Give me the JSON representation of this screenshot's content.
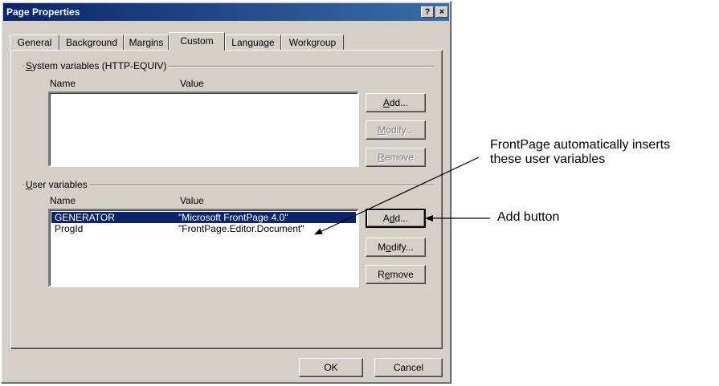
{
  "dialog": {
    "title": "Page Properties",
    "help_label": "?",
    "close_label": "×"
  },
  "tabs": [
    {
      "label": "General"
    },
    {
      "label": "Background"
    },
    {
      "label": "Margins"
    },
    {
      "label": "Custom"
    },
    {
      "label": "Language"
    },
    {
      "label": "Workgroup"
    }
  ],
  "active_tab": "Custom",
  "system_vars": {
    "title_first": "S",
    "title_rest": "ystem variables (HTTP-EQUIV)",
    "col_name": "Name",
    "col_value": "Value",
    "rows": [],
    "buttons": [
      {
        "pre": "",
        "u": "A",
        "post": "dd...",
        "enabled": true
      },
      {
        "pre": "",
        "u": "M",
        "post": "odify...",
        "enabled": false
      },
      {
        "pre": "",
        "u": "R",
        "post": "emove",
        "enabled": false
      }
    ]
  },
  "user_vars": {
    "title_first": "U",
    "title_rest": "ser variables",
    "col_name": "Name",
    "col_value": "Value",
    "rows": [
      {
        "name": "GENERATOR",
        "value": "\"Microsoft FrontPage 4.0\"",
        "selected": true
      },
      {
        "name": "ProgId",
        "value": "\"FrontPage.Editor.Document\"",
        "selected": false
      }
    ],
    "buttons": [
      {
        "pre": "A",
        "u": "d",
        "post": "d...",
        "enabled": true
      },
      {
        "pre": "M",
        "u": "o",
        "post": "dify...",
        "enabled": true
      },
      {
        "pre": "R",
        "u": "e",
        "post": "move",
        "enabled": true
      }
    ]
  },
  "footer": {
    "ok_label": "OK",
    "cancel_label": "Cancel"
  },
  "annotations": {
    "callout_1_line1": "FrontPage automatically inserts",
    "callout_1_line2": "these user variables",
    "callout_2": "Add button"
  }
}
